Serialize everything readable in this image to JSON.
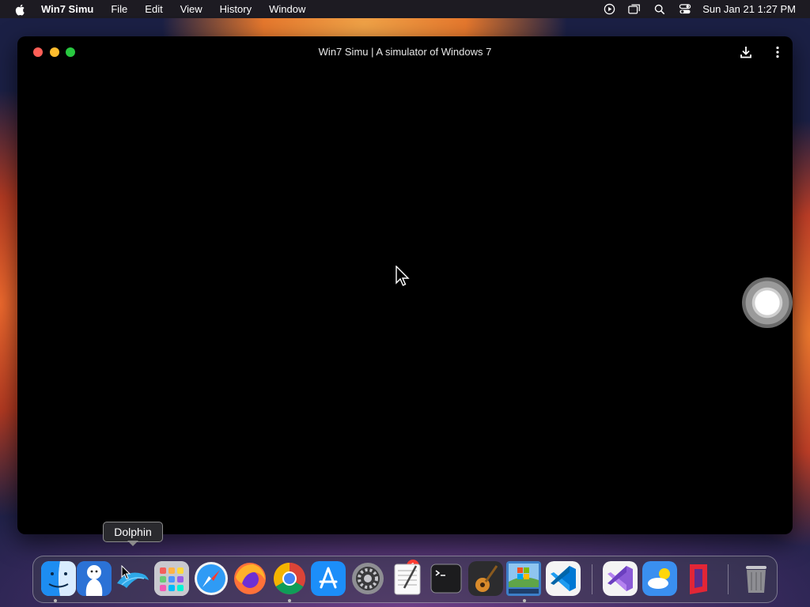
{
  "menubar": {
    "app_name": "Win7 Simu",
    "items": [
      "File",
      "Edit",
      "View",
      "History",
      "Window"
    ],
    "clock": "Sun Jan 21  1:27 PM"
  },
  "window": {
    "title": "Win7 Simu | A simulator of Windows 7"
  },
  "tooltip": {
    "text": "Dolphin"
  },
  "dock": {
    "badge_count": "1",
    "apps": [
      {
        "name": "Finder",
        "icon": "finder-icon"
      },
      {
        "name": "Cursor character app",
        "icon": "character-icon"
      },
      {
        "name": "Dolphin",
        "icon": "dolphin-icon"
      },
      {
        "name": "Launchpad",
        "icon": "launchpad-icon"
      },
      {
        "name": "Safari",
        "icon": "safari-icon"
      },
      {
        "name": "Firefox",
        "icon": "firefox-icon"
      },
      {
        "name": "Chrome",
        "icon": "chrome-icon"
      },
      {
        "name": "App Store",
        "icon": "app-store-icon"
      },
      {
        "name": "System Settings",
        "icon": "system-settings-icon"
      },
      {
        "name": "TextEdit",
        "icon": "textedit-icon"
      },
      {
        "name": "Terminal",
        "icon": "terminal-icon"
      },
      {
        "name": "GarageBand",
        "icon": "garageband-icon"
      },
      {
        "name": "Win7 Simu",
        "icon": "win7-simu-icon"
      },
      {
        "name": "Visual Studio Code",
        "icon": "vscode-icon"
      },
      {
        "name": "Visual Studio",
        "icon": "visual-studio-icon"
      },
      {
        "name": "Weather",
        "icon": "weather-icon"
      },
      {
        "name": "Parallels",
        "icon": "parallels-icon"
      },
      {
        "name": "Trash",
        "icon": "trash-icon"
      }
    ]
  }
}
